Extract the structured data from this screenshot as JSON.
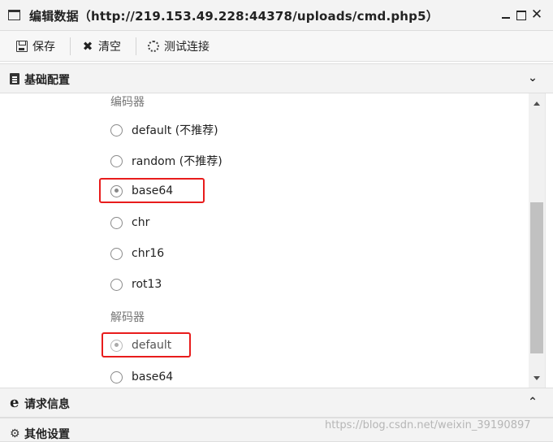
{
  "window": {
    "title": "编辑数据（http://219.153.49.228:44378/uploads/cmd.php5）",
    "title_icon": "window-icon",
    "controls": {
      "minimize_icon": "minimize-icon",
      "maximize_icon": "maximize-icon",
      "close_glyph": "✕"
    }
  },
  "toolbar": {
    "save_label": "保存",
    "clear_label": "清空",
    "test_label": "测试连接",
    "save_icon": "floppy-icon",
    "clear_icon": "x-icon",
    "test_icon": "spinner-icon",
    "clear_glyph": "✖"
  },
  "accordion": {
    "basic": {
      "label": "基础配置",
      "icon": "document-icon",
      "chevron": "⌄",
      "expanded": true
    },
    "request": {
      "label": "请求信息",
      "icon": "ie-icon",
      "icon_glyph": "e",
      "chevron": "⌃",
      "expanded": false
    },
    "other": {
      "label": "其他设置",
      "icon": "gears-icon",
      "icon_glyph": "⚙",
      "chevron": "⌃",
      "expanded": false
    }
  },
  "encoder": {
    "label": "编码器",
    "options": [
      {
        "label": "default (不推荐)",
        "checked": false
      },
      {
        "label": "random (不推荐)",
        "checked": false
      },
      {
        "label": "base64",
        "checked": true
      },
      {
        "label": "chr",
        "checked": false
      },
      {
        "label": "chr16",
        "checked": false
      },
      {
        "label": "rot13",
        "checked": false
      }
    ]
  },
  "decoder": {
    "label": "解码器",
    "options": [
      {
        "label": "default",
        "checked": true,
        "disabled": true
      },
      {
        "label": "base64",
        "checked": false
      }
    ]
  },
  "highlight_color": "#e81c1c",
  "watermark": "https://blog.csdn.net/weixin_39190897"
}
